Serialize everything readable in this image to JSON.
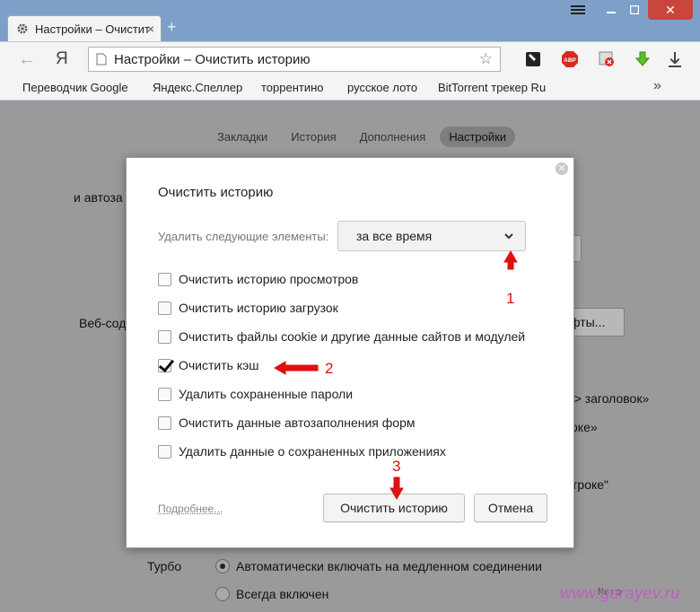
{
  "browser": {
    "tab_title": "Настройки – Очистит",
    "url": "Настройки – Очистить историю",
    "ya_label": "Я",
    "abp_label": "ABP"
  },
  "bookmarks": [
    "Переводчик Google",
    "Яндекс.Спеллер",
    "торрентино",
    "русское лото",
    "BitTorrent трекер Ru"
  ],
  "bookmarks_more": "»",
  "settings_nav": {
    "bookmarks": "Закладки",
    "history": "История",
    "extensions": "Дополнения",
    "settings": "Настройки"
  },
  "background": {
    "t1": "и автоза",
    "t2": "Веб-сод",
    "fonts_btn": "фты...",
    "t3": "н > заголовок»",
    "t4": "оке»",
    "t5": "строке\"",
    "turbo_label": "Турбо",
    "turbo_auto": "Автоматически включать на медленном соединении",
    "turbo_always": "Всегда включен",
    "watermark": "www.garayev.ru",
    "watermark_extra": "Nero"
  },
  "dialog": {
    "title": "Очистить историю",
    "period_label": "Удалить следующие элементы:",
    "period_value": "за все время",
    "options": [
      {
        "label": "Очистить историю просмотров",
        "checked": false
      },
      {
        "label": "Очистить историю загрузок",
        "checked": false
      },
      {
        "label": "Очистить файлы cookie и другие данные сайтов и модулей",
        "checked": false
      },
      {
        "label": "Очистить кэш",
        "checked": true
      },
      {
        "label": "Удалить сохраненные пароли",
        "checked": false
      },
      {
        "label": "Очистить данные автозаполнения форм",
        "checked": false
      },
      {
        "label": "Удалить данные о сохраненных приложениях",
        "checked": false
      }
    ],
    "more_link": "Подробнее...",
    "clear_button": "Очистить историю",
    "cancel_button": "Отмена"
  },
  "annotations": {
    "step1": "1",
    "step2": "2",
    "step3": "3",
    "color": "#d11111"
  }
}
